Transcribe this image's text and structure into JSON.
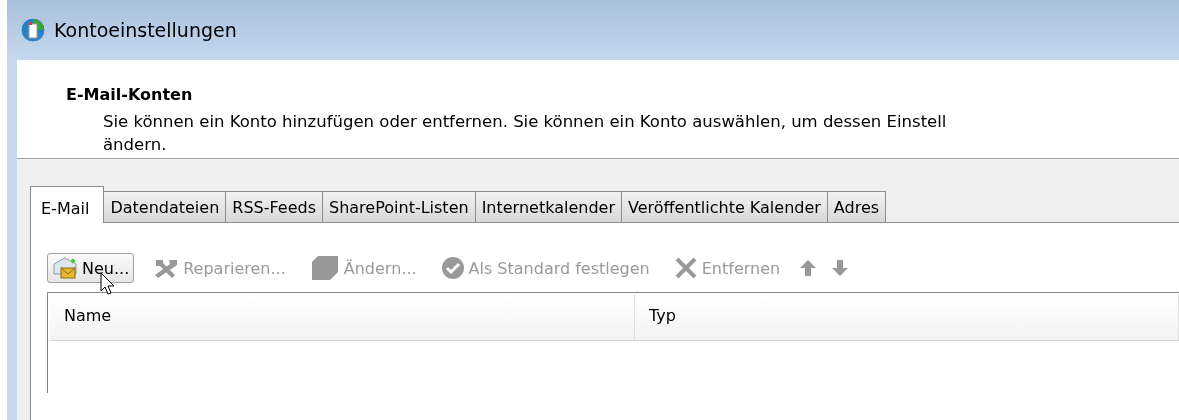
{
  "window": {
    "title": "Kontoeinstellungen"
  },
  "header": {
    "heading": "E-Mail-Konten",
    "description_lines": [
      "Sie können ein Konto hinzufügen oder entfernen. Sie können ein Konto auswählen, um dessen Einstell",
      "ändern."
    ]
  },
  "tabs": [
    {
      "label": "E-Mail",
      "selected": true
    },
    {
      "label": "Datendateien",
      "selected": false
    },
    {
      "label": "RSS-Feeds",
      "selected": false
    },
    {
      "label": "SharePoint-Listen",
      "selected": false
    },
    {
      "label": "Internetkalender",
      "selected": false
    },
    {
      "label": "Veröffentlichte Kalender",
      "selected": false
    },
    {
      "label": "Adres",
      "selected": false
    }
  ],
  "toolbar": [
    {
      "kind": "new",
      "label": "Neu...",
      "disabled": false
    },
    {
      "kind": "repair",
      "label": "Reparieren...",
      "disabled": true
    },
    {
      "kind": "change",
      "label": "Ändern...",
      "disabled": true
    },
    {
      "kind": "default",
      "label": "Als Standard festlegen",
      "disabled": true
    },
    {
      "kind": "remove",
      "label": "Entfernen",
      "disabled": true
    },
    {
      "kind": "up",
      "disabled": true
    },
    {
      "kind": "down",
      "disabled": true
    }
  ],
  "table": {
    "columns": [
      "Name",
      "Typ"
    ]
  }
}
